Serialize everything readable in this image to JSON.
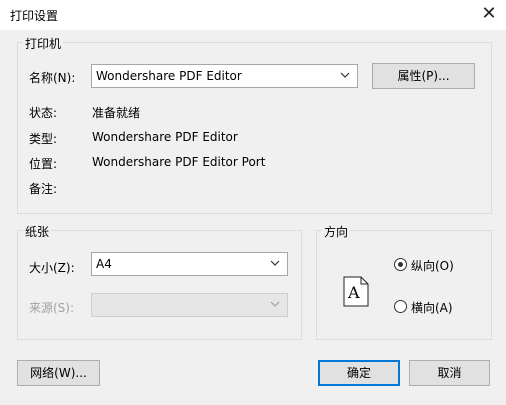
{
  "window": {
    "title": "打印设置",
    "close_glyph": "✕"
  },
  "printer_group": {
    "legend": "打印机",
    "name_label": "名称(N):",
    "name_value": "Wondershare PDF Editor",
    "properties_button": "属性(P)...",
    "status_label": "状态:",
    "status_value": "准备就绪",
    "type_label": "类型:",
    "type_value": "Wondershare PDF Editor",
    "location_label": "位置:",
    "location_value": "Wondershare PDF Editor Port",
    "comment_label": "备注:",
    "comment_value": ""
  },
  "paper_group": {
    "legend": "纸张",
    "size_label": "大小(Z):",
    "size_value": "A4",
    "source_label": "来源(S):",
    "source_value": ""
  },
  "orientation_group": {
    "legend": "方向",
    "portrait_label": "纵向(O)",
    "landscape_label": "横向(A)",
    "selected": "portrait",
    "paper_icon_letter": "A"
  },
  "buttons": {
    "network": "网络(W)...",
    "ok": "确定",
    "cancel": "取消"
  }
}
